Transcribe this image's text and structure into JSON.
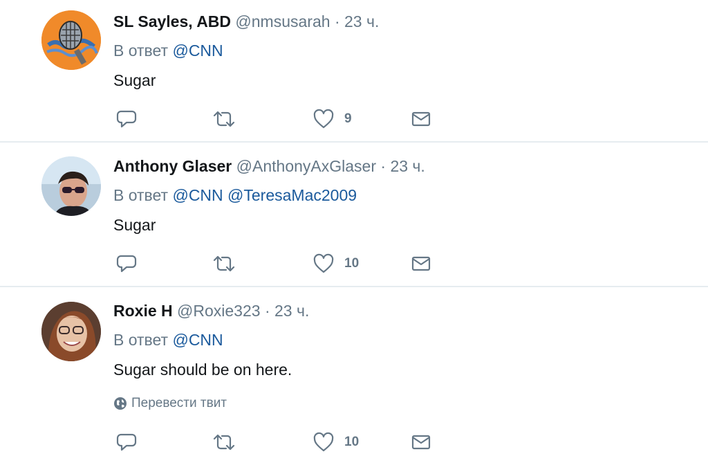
{
  "tweets": [
    {
      "name": "SL Sayles, ABD",
      "handle": "@nmsusarah",
      "dot": "·",
      "time": "23 ч.",
      "reply_prefix": "В ответ",
      "mentions": [
        "@CNN"
      ],
      "text": "Sugar",
      "like_count": "9"
    },
    {
      "name": "Anthony Glaser",
      "handle": "@AnthonyAxGlaser",
      "dot": "·",
      "time": "23 ч.",
      "reply_prefix": "В ответ",
      "mentions": [
        "@CNN",
        "@TeresaMac2009"
      ],
      "text": "Sugar",
      "like_count": "10"
    },
    {
      "name": "Roxie H",
      "handle": "@Roxie323",
      "dot": "·",
      "time": "23 ч.",
      "reply_prefix": "В ответ",
      "mentions": [
        "@CNN"
      ],
      "text": "Sugar should be on here.",
      "translate_label": "Перевести твит",
      "like_count": "10"
    }
  ],
  "icons": {
    "reply": "reply-icon",
    "retweet": "retweet-icon",
    "like": "heart-icon",
    "dm": "envelope-icon",
    "translate": "globe-icon"
  },
  "colors": {
    "name": "#14171a",
    "secondary": "#657786",
    "mention": "#1b5a9c",
    "divider": "#e6ecf0"
  }
}
